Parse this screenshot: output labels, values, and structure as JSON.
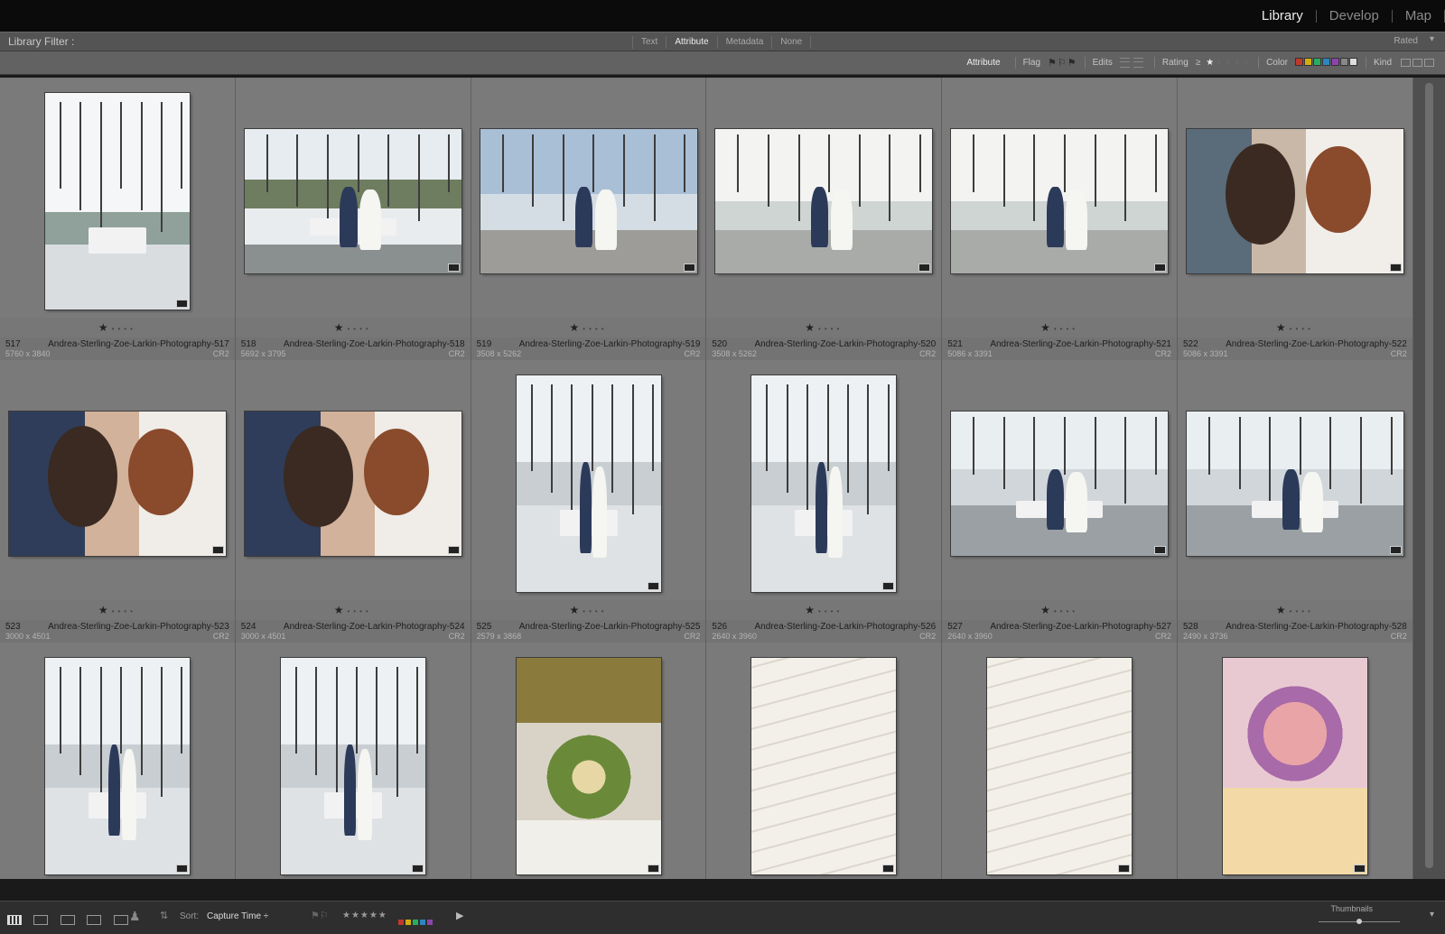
{
  "modules": [
    "Library",
    "Develop",
    "Map"
  ],
  "active_module": "Library",
  "filter_bar": {
    "title": "Library Filter :",
    "tabs": [
      "Text",
      "Attribute",
      "Metadata",
      "None"
    ],
    "active_tab": "Attribute",
    "rated_label": "Rated"
  },
  "attribute_bar": {
    "attribute_label": "Attribute",
    "flag_label": "Flag",
    "edits_label": "Edits",
    "rating_label": "Rating",
    "rating_op": "≥",
    "color_label": "Color",
    "kind_label": "Kind",
    "color_swatches": [
      "#c0392b",
      "#d4ac0d",
      "#27ae60",
      "#2e86c1",
      "#8e44ad",
      "#888888",
      "#dddddd"
    ]
  },
  "photos": [
    {
      "num": "517",
      "name": "Andrea-Sterling-Zoe-Larkin-Photography-517",
      "dims": "5760 x 3840",
      "type": "CR2",
      "orient": "port",
      "scene": "marina"
    },
    {
      "num": "518",
      "name": "Andrea-Sterling-Zoe-Larkin-Photography-518",
      "dims": "5692 x 3795",
      "type": "CR2",
      "orient": "land",
      "scene": "boat"
    },
    {
      "num": "519",
      "name": "Andrea-Sterling-Zoe-Larkin-Photography-519",
      "dims": "3508 x 5262",
      "type": "CR2",
      "orient": "land",
      "scene": "couple-sky"
    },
    {
      "num": "520",
      "name": "Andrea-Sterling-Zoe-Larkin-Photography-520",
      "dims": "3508 x 5262",
      "type": "CR2",
      "orient": "land",
      "scene": "couple-sail"
    },
    {
      "num": "521",
      "name": "Andrea-Sterling-Zoe-Larkin-Photography-521",
      "dims": "5086 x 3391",
      "type": "CR2",
      "orient": "land",
      "scene": "couple-sail"
    },
    {
      "num": "522",
      "name": "Andrea-Sterling-Zoe-Larkin-Photography-522",
      "dims": "5086 x 3391",
      "type": "CR2",
      "orient": "land",
      "scene": "closeup"
    },
    {
      "num": "523",
      "name": "Andrea-Sterling-Zoe-Larkin-Photography-523",
      "dims": "3000 x 4501",
      "type": "CR2",
      "orient": "land",
      "scene": "closeup2"
    },
    {
      "num": "524",
      "name": "Andrea-Sterling-Zoe-Larkin-Photography-524",
      "dims": "3000 x 4501",
      "type": "CR2",
      "orient": "land",
      "scene": "closeup2"
    },
    {
      "num": "525",
      "name": "Andrea-Sterling-Zoe-Larkin-Photography-525",
      "dims": "2579 x 3868",
      "type": "CR2",
      "orient": "port",
      "scene": "dock"
    },
    {
      "num": "526",
      "name": "Andrea-Sterling-Zoe-Larkin-Photography-526",
      "dims": "2640 x 3960",
      "type": "CR2",
      "orient": "port",
      "scene": "dock"
    },
    {
      "num": "527",
      "name": "Andrea-Sterling-Zoe-Larkin-Photography-527",
      "dims": "2640 x 3960",
      "type": "CR2",
      "orient": "land",
      "scene": "dock-wide"
    },
    {
      "num": "528",
      "name": "Andrea-Sterling-Zoe-Larkin-Photography-528",
      "dims": "2490 x 3736",
      "type": "CR2",
      "orient": "land",
      "scene": "dock-wide"
    },
    {
      "num": "",
      "name": "",
      "dims": "",
      "type": "",
      "orient": "port",
      "scene": "dock"
    },
    {
      "num": "",
      "name": "",
      "dims": "",
      "type": "",
      "orient": "port",
      "scene": "dock"
    },
    {
      "num": "",
      "name": "",
      "dims": "",
      "type": "",
      "orient": "port",
      "scene": "flowers"
    },
    {
      "num": "",
      "name": "",
      "dims": "",
      "type": "",
      "orient": "port",
      "scene": "cards"
    },
    {
      "num": "",
      "name": "",
      "dims": "",
      "type": "",
      "orient": "port",
      "scene": "cards"
    },
    {
      "num": "",
      "name": "",
      "dims": "",
      "type": "",
      "orient": "port",
      "scene": "vase"
    }
  ],
  "rating_stars": 1,
  "toolbar": {
    "sort_label": "Sort:",
    "sort_value": "Capture Time ÷",
    "thumbnails_label": "Thumbnails",
    "label_colors": [
      "#c0392b",
      "#d4ac0d",
      "#27ae60",
      "#2e86c1",
      "#8e44ad"
    ]
  }
}
